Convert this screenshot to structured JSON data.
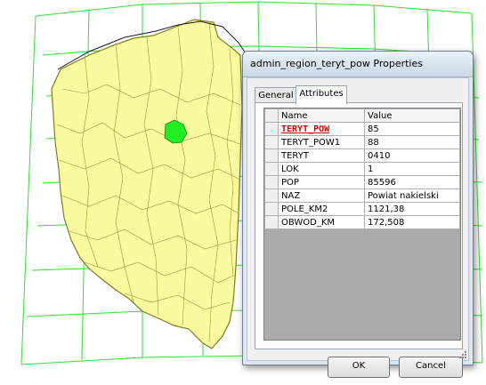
{
  "dialog": {
    "title": "admin_region_teryt_pow Properties",
    "tabs": [
      {
        "label": "General",
        "active": false
      },
      {
        "label": "Attributes",
        "active": true
      }
    ],
    "table": {
      "headers": {
        "name": "Name",
        "value": "Value"
      },
      "rows": [
        {
          "name": "TERYT_POW",
          "value": "85"
        },
        {
          "name": "TERYT_POW1",
          "value": "88"
        },
        {
          "name": "TERYT",
          "value": "0410"
        },
        {
          "name": "LOK",
          "value": "1"
        },
        {
          "name": "POP",
          "value": "85596"
        },
        {
          "name": "NAZ",
          "value": "Powiat nakielski"
        },
        {
          "name": "POLE_KM2",
          "value": "1121,38"
        },
        {
          "name": "OBWOD_KM",
          "value": "172,508"
        }
      ]
    },
    "buttons": {
      "ok": "OK",
      "cancel": "Cancel"
    }
  },
  "colors": {
    "region_fill": "#fafaa0",
    "region_border": "#7f7f1a",
    "selected_region": "#22ee22",
    "graticule": "#33dd33"
  }
}
